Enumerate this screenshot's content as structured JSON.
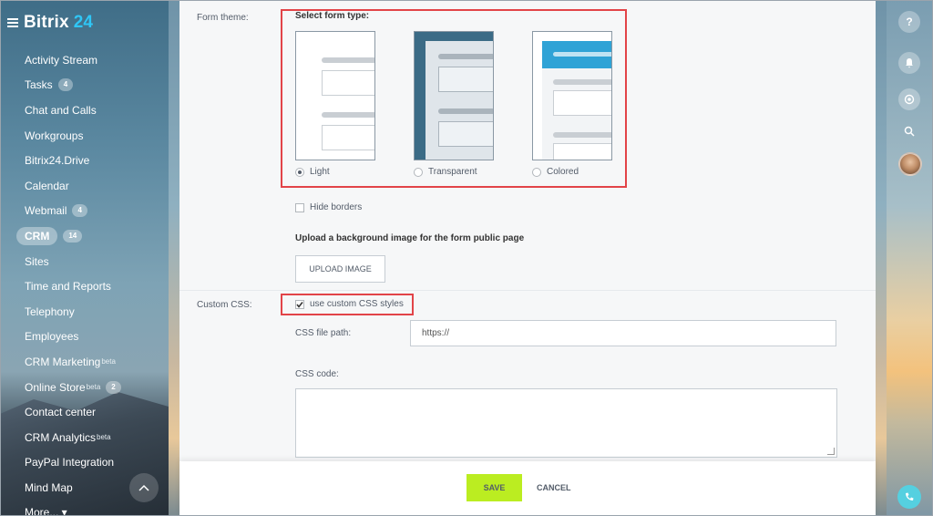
{
  "app": {
    "name": "Bitrix",
    "version": "24"
  },
  "sidebar": {
    "items": [
      {
        "label": "Activity Stream"
      },
      {
        "label": "Tasks",
        "count": "4"
      },
      {
        "label": "Chat and Calls"
      },
      {
        "label": "Workgroups"
      },
      {
        "label": "Bitrix24.Drive"
      },
      {
        "label": "Calendar"
      },
      {
        "label": "Webmail",
        "count": "4"
      },
      {
        "label": "CRM",
        "count": "14",
        "active": true
      },
      {
        "label": "Sites"
      },
      {
        "label": "Time and Reports"
      },
      {
        "label": "Telephony"
      },
      {
        "label": "Employees"
      },
      {
        "label": "CRM Marketing",
        "sup": "beta"
      },
      {
        "label": "Online Store",
        "sup": "beta",
        "count": "2"
      },
      {
        "label": "Contact center"
      },
      {
        "label": "CRM Analytics",
        "sup": "beta"
      },
      {
        "label": "PayPal Integration"
      },
      {
        "label": "Mind Map"
      },
      {
        "label": "More... ▾"
      }
    ]
  },
  "form": {
    "theme_label": "Form theme:",
    "select_title": "Select form type:",
    "types": [
      {
        "label": "Light",
        "selected": true
      },
      {
        "label": "Transparent",
        "selected": false
      },
      {
        "label": "Colored",
        "selected": false
      }
    ],
    "hide_borders_label": "Hide borders",
    "hide_borders_checked": false,
    "upload_title": "Upload a background image for the form public page",
    "upload_button": "UPLOAD IMAGE",
    "custom_css_label": "Custom CSS:",
    "use_custom_css_label": "use custom CSS styles",
    "use_custom_css_checked": true,
    "css_file_path_label": "CSS file path:",
    "css_file_path_value": "https://",
    "css_code_label": "CSS code:",
    "css_code_value": ""
  },
  "footer": {
    "save": "SAVE",
    "cancel": "CANCEL"
  },
  "rightbar": {
    "icons": [
      "help-icon",
      "bell-icon",
      "chat-search-icon",
      "search-icon",
      "avatar",
      "phone-icon"
    ]
  },
  "colors": {
    "accent_save": "#bbed21",
    "highlight": "#e24448",
    "logo_num": "#2fc6f6",
    "colored_theme": "#2fa3d6",
    "transparent_theme": "#3b6b86"
  }
}
